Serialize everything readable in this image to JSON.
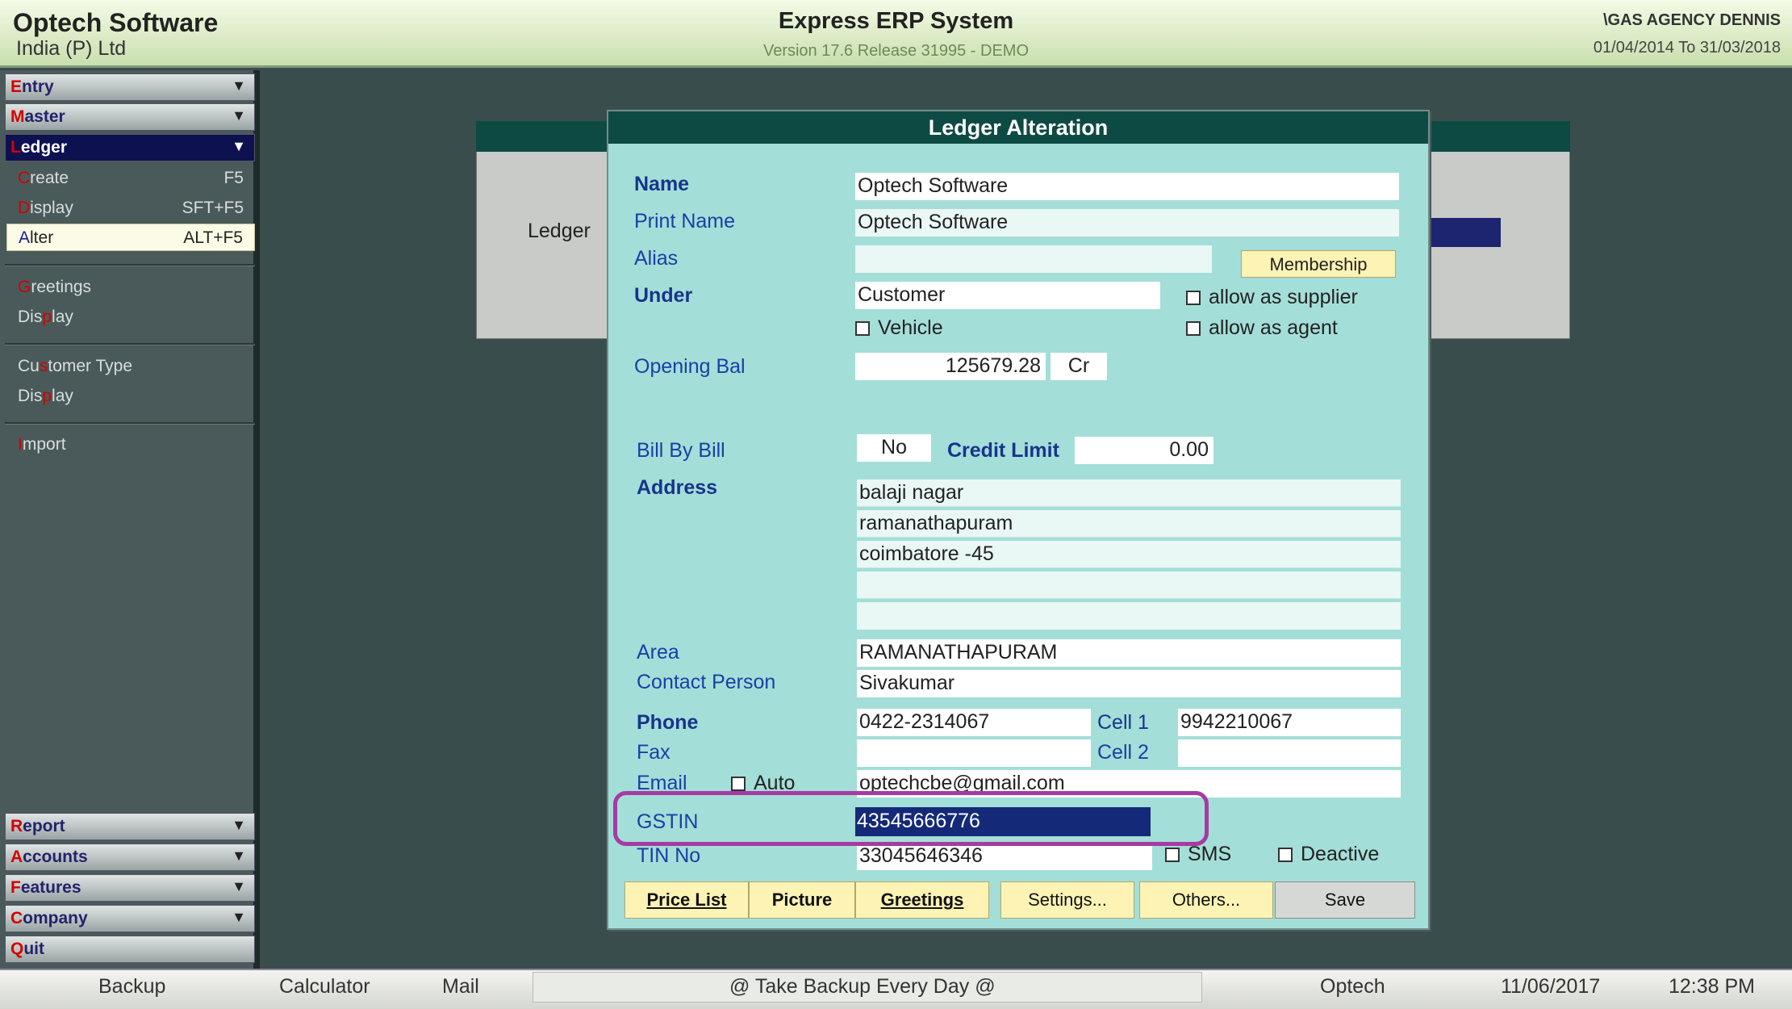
{
  "header": {
    "company_line1": "Optech Software",
    "company_line2": "India (P) Ltd",
    "app_title": "Express ERP System",
    "version": "Version 17.6 Release 31995 - DEMO",
    "agency": "\\GAS AGENCY DENNIS",
    "period": "01/04/2014 To 31/03/2018"
  },
  "sidebar": {
    "entry": {
      "hot": "E",
      "rest": "ntry"
    },
    "master": {
      "hot": "M",
      "rest": "aster"
    },
    "ledger": {
      "hot": "L",
      "rest": "edger"
    },
    "ledger_items": [
      {
        "hot": "C",
        "rest": "reate",
        "key": "F5"
      },
      {
        "hot": "D",
        "rest": "isplay",
        "key": "SFT+F5"
      },
      {
        "hot": "A",
        "rest": "lter",
        "key": "ALT+F5"
      }
    ],
    "greetings": {
      "hot": "G",
      "rest": "reetings"
    },
    "greet_display": {
      "a": "Dis",
      "hot": "p",
      "b": "lay"
    },
    "customer_type": {
      "a": "Cu",
      "hot": "s",
      "b": "tomer Type"
    },
    "ct_display": {
      "a": "Dis",
      "hot": "p",
      "b": "lay"
    },
    "import": {
      "hot": "I",
      "rest": "mport"
    },
    "report": {
      "hot": "R",
      "rest": "eport"
    },
    "accounts": {
      "hot": "A",
      "rest": "ccounts"
    },
    "features": {
      "hot": "F",
      "rest": "eatures"
    },
    "company": {
      "hot": "C",
      "rest": "ompany"
    },
    "quit": {
      "hot": "Q",
      "rest": "uit"
    }
  },
  "background": {
    "label": "Ledger"
  },
  "dialog": {
    "title": "Ledger Alteration",
    "labels": {
      "name": "Name",
      "print_name": "Print Name",
      "alias": "Alias",
      "under": "Under",
      "opening_bal": "Opening Bal",
      "bill_by_bill": "Bill By Bill",
      "credit_limit": "Credit Limit",
      "address": "Address",
      "area": "Area",
      "contact_person": "Contact Person",
      "phone": "Phone",
      "cell1": "Cell 1",
      "fax": "Fax",
      "cell2": "Cell 2",
      "email": "Email",
      "gstin": "GSTIN",
      "tin_no": "TIN No"
    },
    "values": {
      "name": "Optech Software",
      "print_name": "Optech Software",
      "alias": "",
      "under": "Customer",
      "opening_bal": "125679.28",
      "dr_cr": "Cr",
      "bill_by_bill": "No",
      "credit_limit": "0.00",
      "address": [
        "balaji nagar",
        "ramanathapuram",
        "coimbatore -45",
        "",
        ""
      ],
      "area": "RAMANATHAPURAM",
      "contact_person": "Sivakumar",
      "phone": "0422-2314067",
      "cell1": "9942210067",
      "fax": "",
      "cell2": "",
      "email": "optechcbe@gmail.com",
      "gstin": "43545666776",
      "tin_no": "33045646346"
    },
    "checkboxes": {
      "allow_supplier": "allow as supplier",
      "vehicle": "Vehicle",
      "allow_agent": "allow as agent",
      "auto": "Auto",
      "sms": "SMS",
      "deactive": "Deactive"
    },
    "buttons": {
      "membership": "Membership",
      "price_list": "Price List",
      "picture": "Picture",
      "greetings": "Greetings",
      "settings": "Settings...",
      "others": "Others...",
      "save": "Save"
    }
  },
  "statusbar": {
    "backup": "Backup",
    "calculator": "Calculator",
    "mail": "Mail",
    "message": "@ Take Backup Every Day @",
    "user": "Optech",
    "date": "11/06/2017",
    "time": "12:38 PM"
  }
}
